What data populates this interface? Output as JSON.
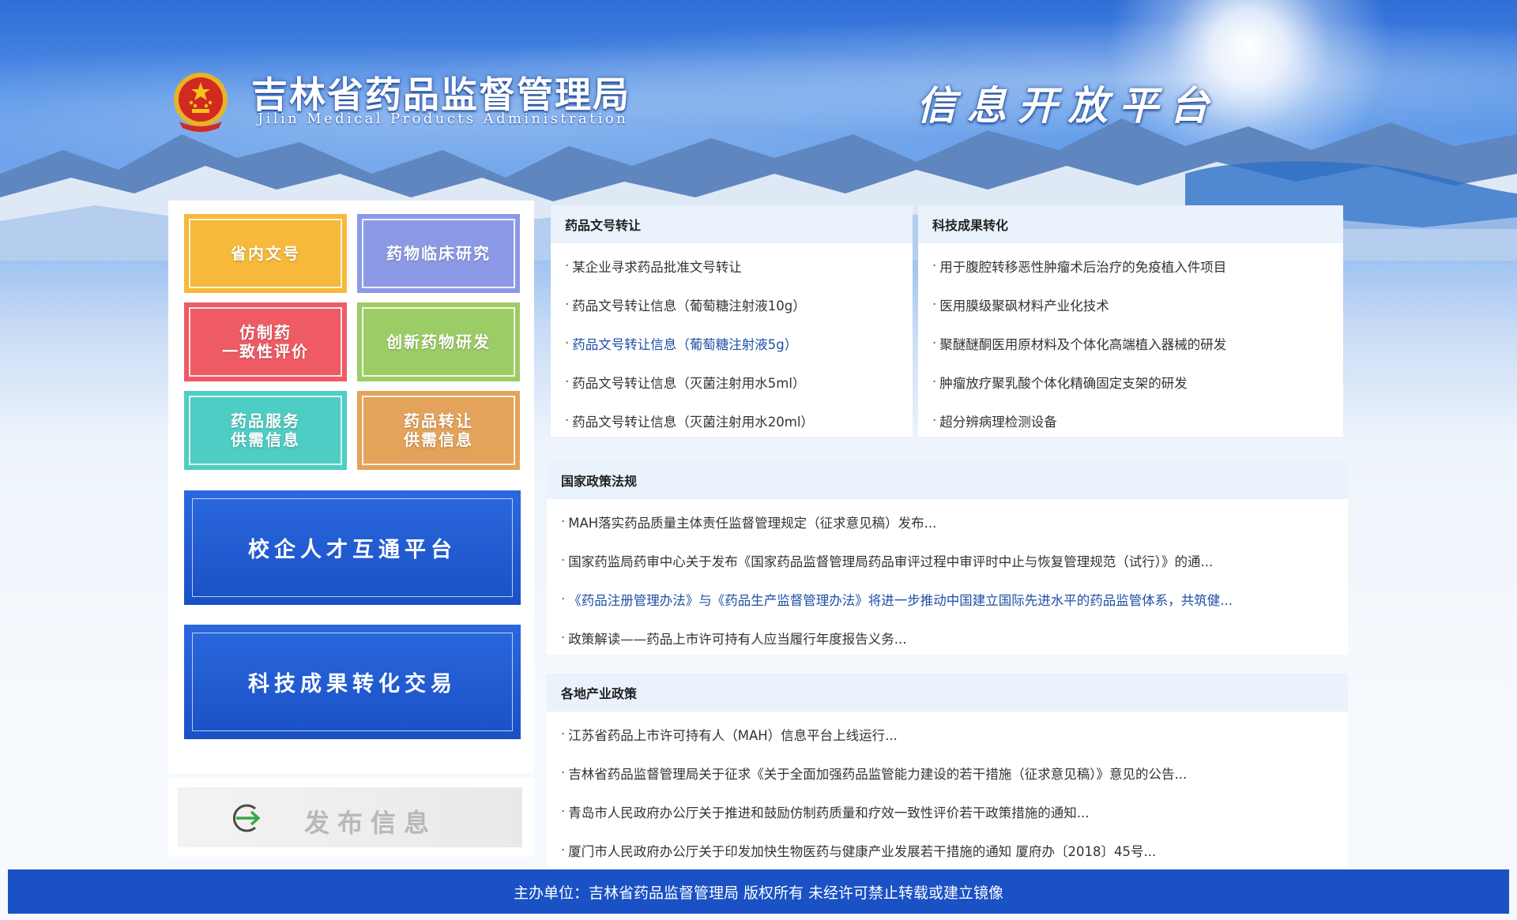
{
  "header": {
    "title_cn": "吉林省药品监督管理局",
    "title_en": "Jilin Medical Products Administration",
    "slogan": "信息开放平台",
    "emblem_icon": "national-emblem-icon"
  },
  "tiles": [
    {
      "label": "省内文号",
      "color": "#f6b93b"
    },
    {
      "label": "药物临床研究",
      "color": "#8c9ae6"
    },
    {
      "label": "仿制药\n一致性评价",
      "color": "#ef5b64"
    },
    {
      "label": "创新药物研发",
      "color": "#9ccc65"
    },
    {
      "label": "药品服务\n供需信息",
      "color": "#4ecdc4"
    },
    {
      "label": "药品转让\n供需信息",
      "color": "#e3a35a"
    }
  ],
  "platform_buttons": [
    {
      "label": "校企人才互通平台"
    },
    {
      "label": "科技成果转化交易"
    }
  ],
  "publish": {
    "label": "发布信息",
    "icon": "arrow-right-circle-icon"
  },
  "panels": {
    "transfer": {
      "title": "药品文号转让",
      "items": [
        "某企业寻求药品批准文号转让",
        "药品文号转让信息（葡萄糖注射液10g）",
        "药品文号转让信息（葡萄糖注射液5g）",
        "药品文号转让信息（灭菌注射用水5ml）",
        "药品文号转让信息（灭菌注射用水20ml）"
      ]
    },
    "tech": {
      "title": "科技成果转化",
      "items": [
        "用于腹腔转移恶性肿瘤术后治疗的免疫植入件项目",
        "医用膜级聚砜材料产业化技术",
        "聚醚醚酮医用原材料及个体化高端植入器械的研发",
        "肿瘤放疗聚乳酸个体化精确固定支架的研发",
        "超分辨病理检测设备"
      ]
    },
    "national": {
      "title": "国家政策法规",
      "items": [
        "MAH落实药品质量主体责任监督管理规定（征求意见稿）发布...",
        "国家药监局药审中心关于发布《国家药品监督管理局药品审评过程中审评时中止与恢复管理规范（试行）》的通...",
        "《药品注册管理办法》与《药品生产监督管理办法》将进一步推动中国建立国际先进水平的药品监管体系，共筑健...",
        "政策解读——药品上市许可持有人应当履行年度报告义务..."
      ]
    },
    "local": {
      "title": "各地产业政策",
      "items": [
        "江苏省药品上市许可持有人（MAH）信息平台上线运行...",
        "吉林省药品监督管理局关于征求《关于全面加强药品监管能力建设的若干措施（征求意见稿）》意见的公告...",
        "青岛市人民政府办公厅关于推进和鼓励仿制药质量和疗效一致性评价若干政策措施的通知...",
        "厦门市人民政府办公厅关于印发加快生物医药与健康产业发展若干措施的通知 厦府办〔2018〕45号..."
      ]
    }
  },
  "footer": {
    "text": "主办单位：吉林省药品监督管理局 版权所有 未经许可禁止转载或建立镜像"
  },
  "colors": {
    "accent": "#1a51c4",
    "link_active": "#1d4fa6",
    "panel_head": "#eaf2fc"
  }
}
